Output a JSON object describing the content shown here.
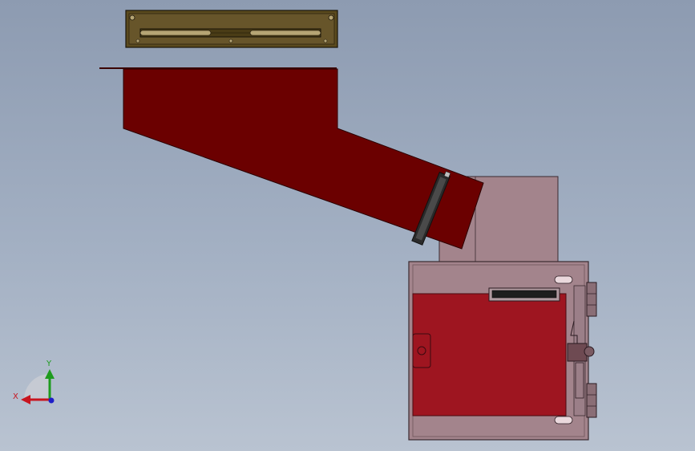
{
  "viewport": {
    "colors": {
      "background_top": "#8d9bb1",
      "background_bottom": "#b9c3d1",
      "chute": "#6b0000",
      "housing": "#a3848c",
      "housing_inner": "#9e1520",
      "bracket": "#5a4a1e"
    }
  },
  "triad": {
    "x_label": "X",
    "y_label": "Y",
    "x_color": "#c8141e",
    "y_color": "#1e9b1e",
    "z_color": "#1e1ec8"
  }
}
